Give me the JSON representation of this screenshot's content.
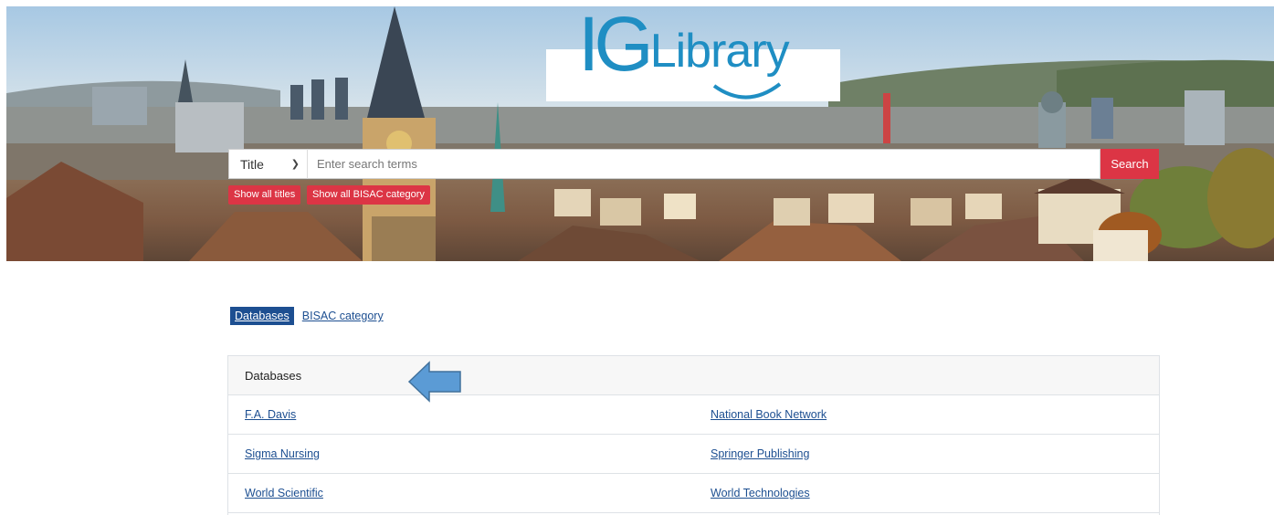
{
  "header": {
    "logo_ig": "IG",
    "logo_library": "Library",
    "search": {
      "field_selected": "Title",
      "placeholder": "Enter search terms",
      "button_label": "Search"
    },
    "quick_links": [
      "Show all titles",
      "Show all BISAC category"
    ]
  },
  "tabs": {
    "active": "Databases",
    "inactive": "BISAC category"
  },
  "panel": {
    "heading": "Databases",
    "rows": [
      [
        "F.A. Davis",
        "National Book Network"
      ],
      [
        "Sigma Nursing",
        "Springer Publishing"
      ],
      [
        "World Scientific",
        "World Technologies"
      ]
    ]
  },
  "icons": {
    "pointer": "left-arrow-icon",
    "dropdown": "chevron-down-icon"
  },
  "colors": {
    "brand_blue": "#1f8ec3",
    "link_blue": "#1d4f91",
    "accent_red": "#dc3545",
    "arrow_blue": "#5b9bd5"
  }
}
